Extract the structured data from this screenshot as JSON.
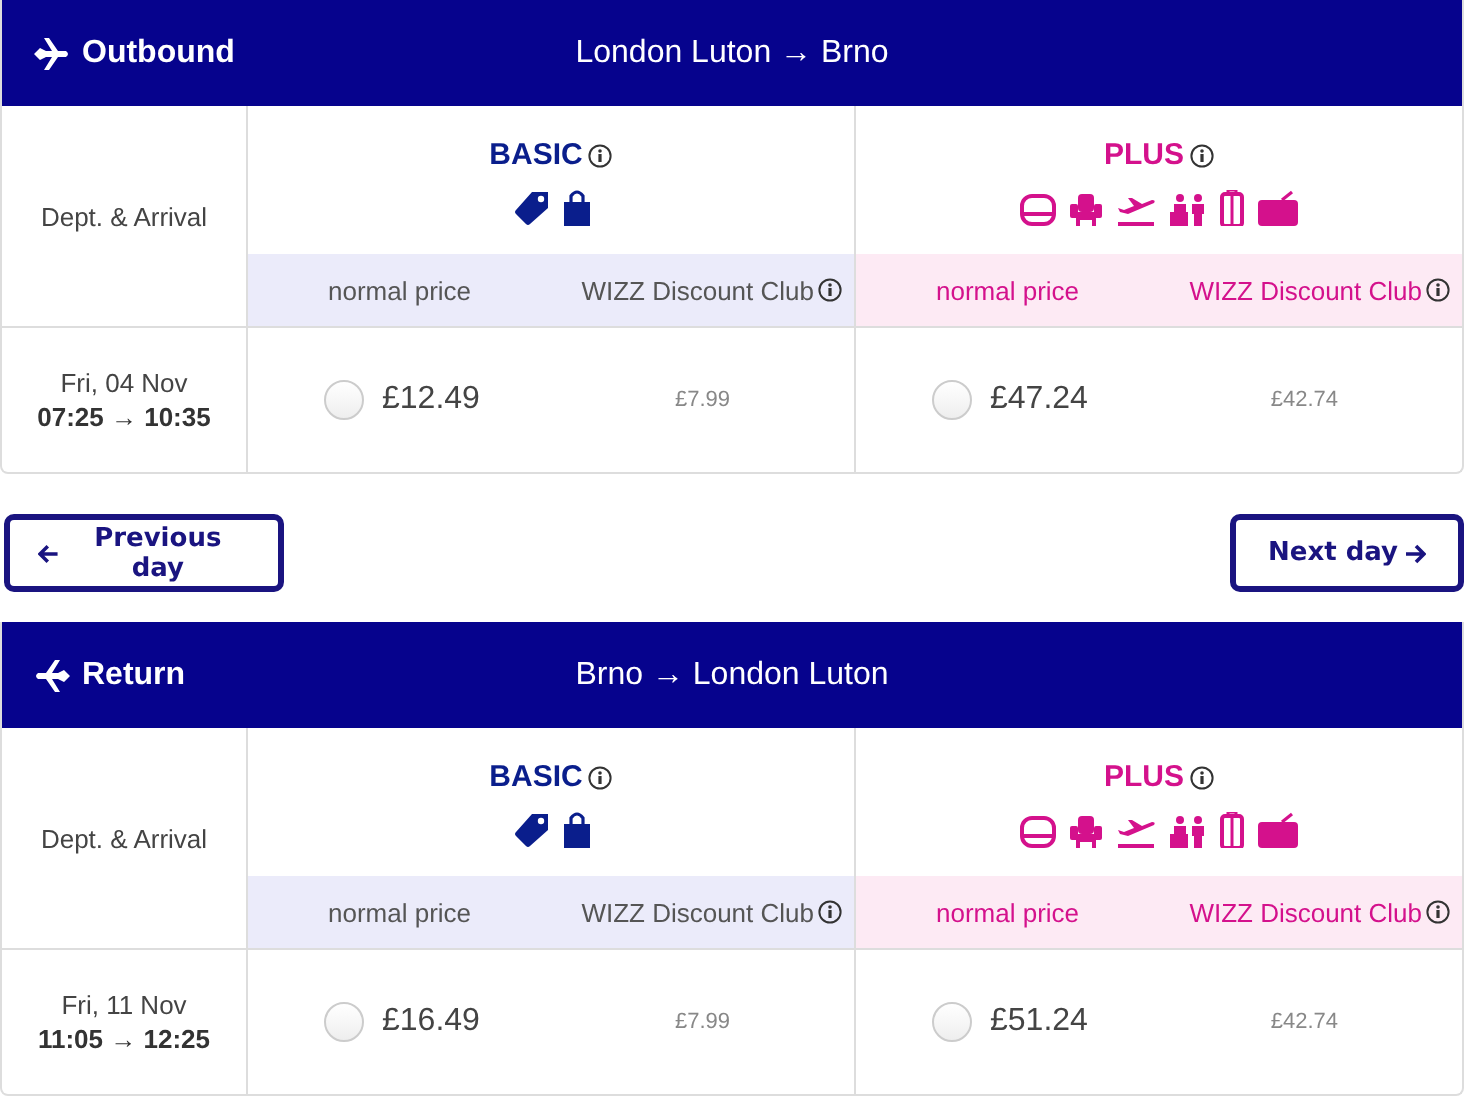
{
  "sections": [
    {
      "kind": "outbound",
      "title": "Outbound",
      "route": "London Luton → Brno",
      "column_label": "Dept. & Arrival",
      "fares": [
        {
          "kind": "basic",
          "name": "BASIC",
          "price_label": "normal price",
          "club_label": "WIZZ Discount Club"
        },
        {
          "kind": "plus",
          "name": "PLUS",
          "price_label": "normal price",
          "club_label": "WIZZ Discount Club"
        }
      ],
      "flight": {
        "date": "Fri, 04 Nov",
        "times": "07:25 → 10:35",
        "options": [
          {
            "price": "£12.49",
            "club_price": "£7.99",
            "selected": false
          },
          {
            "price": "£47.24",
            "club_price": "£42.74",
            "selected": false
          }
        ]
      }
    },
    {
      "kind": "return",
      "title": "Return",
      "route": "Brno → London Luton",
      "column_label": "Dept. & Arrival",
      "fares": [
        {
          "kind": "basic",
          "name": "BASIC",
          "price_label": "normal price",
          "club_label": "WIZZ Discount Club"
        },
        {
          "kind": "plus",
          "name": "PLUS",
          "price_label": "normal price",
          "club_label": "WIZZ Discount Club"
        }
      ],
      "flight": {
        "date": "Fri, 11 Nov",
        "times": "11:05 → 12:25",
        "options": [
          {
            "price": "£16.49",
            "club_price": "£7.99",
            "selected": false
          },
          {
            "price": "£51.24",
            "club_price": "£42.74",
            "selected": false
          }
        ]
      }
    }
  ],
  "nav": {
    "previous": "Previous day",
    "next": "Next day"
  }
}
